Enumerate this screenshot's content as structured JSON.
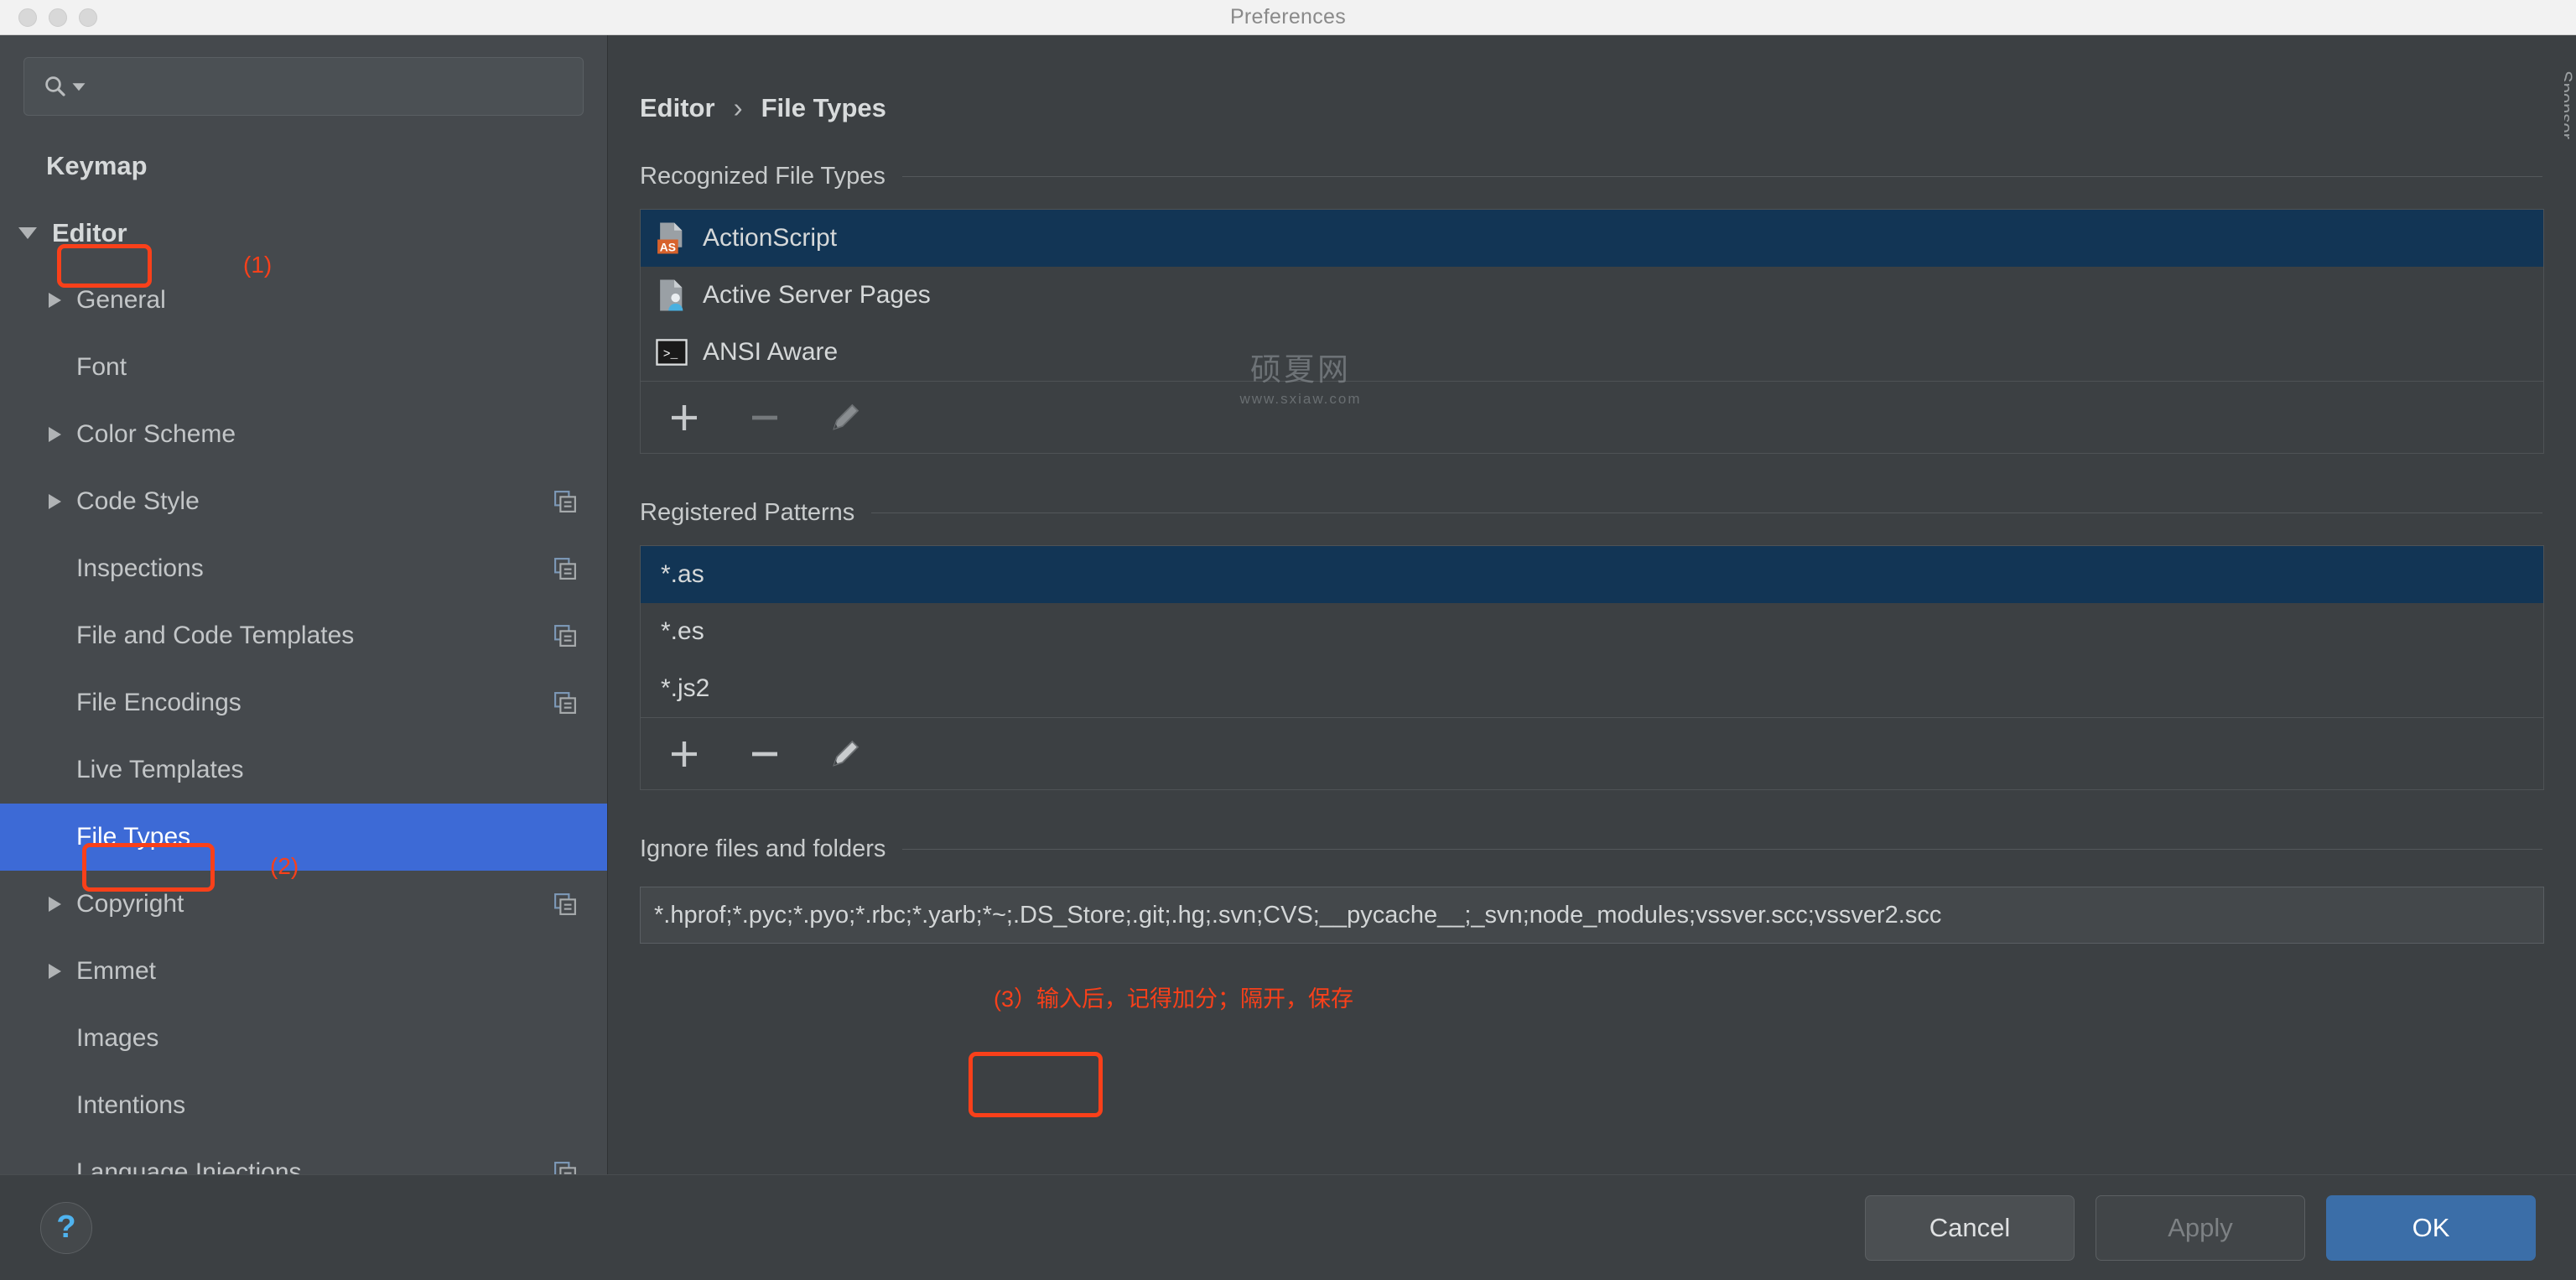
{
  "window": {
    "title": "Preferences",
    "traffic_lights": [
      "close",
      "minimize",
      "zoom"
    ]
  },
  "sidebar": {
    "search": {
      "placeholder": "",
      "value": "",
      "icon": "search-icon"
    },
    "items": [
      {
        "label": "Keymap",
        "depth": 0,
        "arrow": "none",
        "bold": true,
        "selected": false,
        "copy_icon": false
      },
      {
        "label": "Editor",
        "depth": 0,
        "arrow": "down",
        "bold": true,
        "selected": false,
        "copy_icon": false
      },
      {
        "label": "General",
        "depth": 1,
        "arrow": "right",
        "bold": false,
        "selected": false,
        "copy_icon": false
      },
      {
        "label": "Font",
        "depth": 1,
        "arrow": "none",
        "bold": false,
        "selected": false,
        "copy_icon": false
      },
      {
        "label": "Color Scheme",
        "depth": 1,
        "arrow": "right",
        "bold": false,
        "selected": false,
        "copy_icon": false
      },
      {
        "label": "Code Style",
        "depth": 1,
        "arrow": "right",
        "bold": false,
        "selected": false,
        "copy_icon": true
      },
      {
        "label": "Inspections",
        "depth": 1,
        "arrow": "none",
        "bold": false,
        "selected": false,
        "copy_icon": true
      },
      {
        "label": "File and Code Templates",
        "depth": 1,
        "arrow": "none",
        "bold": false,
        "selected": false,
        "copy_icon": true
      },
      {
        "label": "File Encodings",
        "depth": 1,
        "arrow": "none",
        "bold": false,
        "selected": false,
        "copy_icon": true
      },
      {
        "label": "Live Templates",
        "depth": 1,
        "arrow": "none",
        "bold": false,
        "selected": false,
        "copy_icon": false
      },
      {
        "label": "File Types",
        "depth": 1,
        "arrow": "none",
        "bold": false,
        "selected": true,
        "copy_icon": false
      },
      {
        "label": "Copyright",
        "depth": 1,
        "arrow": "right",
        "bold": false,
        "selected": false,
        "copy_icon": true
      },
      {
        "label": "Emmet",
        "depth": 1,
        "arrow": "right",
        "bold": false,
        "selected": false,
        "copy_icon": false
      },
      {
        "label": "Images",
        "depth": 1,
        "arrow": "none",
        "bold": false,
        "selected": false,
        "copy_icon": false
      },
      {
        "label": "Intentions",
        "depth": 1,
        "arrow": "none",
        "bold": false,
        "selected": false,
        "copy_icon": false
      },
      {
        "label": "Language Injections",
        "depth": 1,
        "arrow": "none",
        "bold": false,
        "selected": false,
        "copy_icon": true
      }
    ]
  },
  "annotations": [
    {
      "id": "1",
      "text": "(1)"
    },
    {
      "id": "2",
      "text": "(2)"
    },
    {
      "id": "3",
      "text": "(3）输入后，记得加分；隔开，保存"
    }
  ],
  "main": {
    "breadcrumb": {
      "parent": "Editor",
      "separator": "›",
      "current": "File Types"
    },
    "recognized": {
      "title": "Recognized File Types",
      "items": [
        {
          "name": "ActionScript",
          "icon": "actionscript-file-icon",
          "selected": true
        },
        {
          "name": "Active Server Pages",
          "icon": "asp-file-icon",
          "selected": false
        },
        {
          "name": "ANSI Aware",
          "icon": "terminal-file-icon",
          "selected": false
        }
      ],
      "toolbar": [
        {
          "icon": "plus-icon",
          "label": "+",
          "enabled": true
        },
        {
          "icon": "minus-icon",
          "label": "−",
          "enabled": false
        },
        {
          "icon": "pencil-icon",
          "label": "✎",
          "enabled": false
        }
      ]
    },
    "patterns": {
      "title": "Registered Patterns",
      "items": [
        {
          "name": "*.as",
          "selected": true
        },
        {
          "name": "*.es",
          "selected": false
        },
        {
          "name": "*.js2",
          "selected": false
        }
      ],
      "toolbar": [
        {
          "icon": "plus-icon",
          "label": "+",
          "enabled": true
        },
        {
          "icon": "minus-icon",
          "label": "−",
          "enabled": true
        },
        {
          "icon": "pencil-icon",
          "label": "✎",
          "enabled": true
        }
      ]
    },
    "ignore": {
      "title": "Ignore files and folders",
      "value": "*.hprof;*.pyc;*.pyo;*.rbc;*.yarb;*~;.DS_Store;.git;.hg;.svn;CVS;__pycache__;_svn;node_modules;vssver.scc;vssver2.scc",
      "placeholder": ""
    }
  },
  "footer": {
    "help": {
      "icon": "question-mark-icon",
      "label": "?"
    },
    "cancel": "Cancel",
    "apply": "Apply",
    "ok": "OK"
  },
  "watermark": {
    "main": "硕夏网",
    "sub": "www.sxiaw.com"
  },
  "edge_sliver": "Sponsor",
  "colors": {
    "accent_blue": "#3d6ad6",
    "annotation_red": "#f9401a",
    "selection_navy": "#123555",
    "primary_button": "#3b6ea8",
    "sidebar_bg": "#45494d",
    "panel_bg": "#3c4043"
  }
}
